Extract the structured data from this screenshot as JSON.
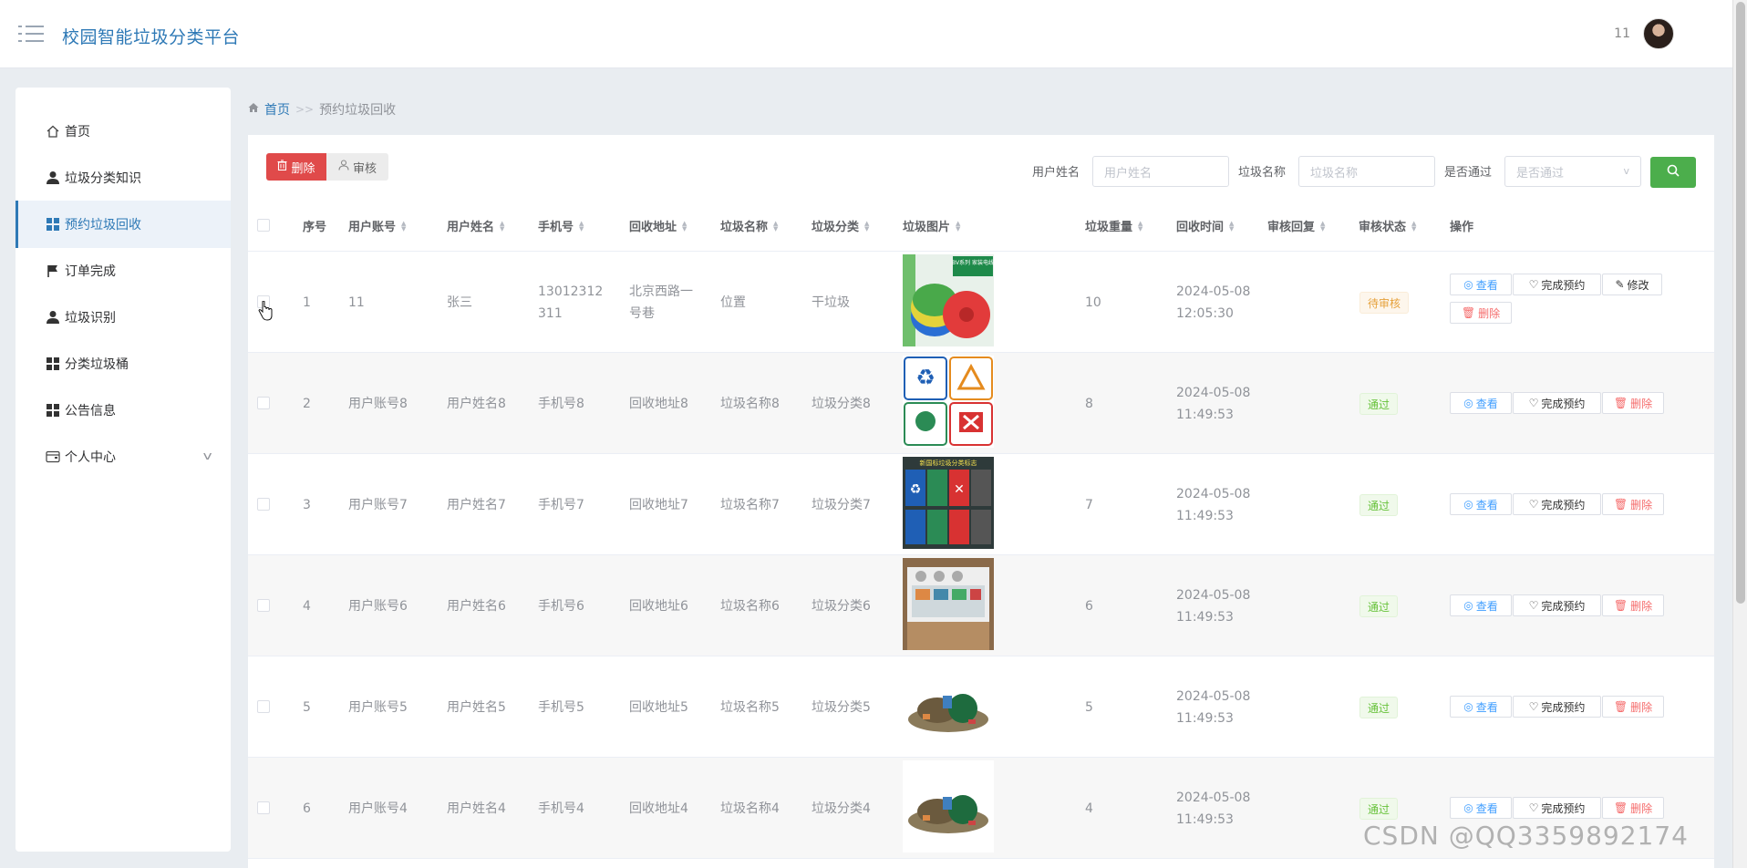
{
  "header": {
    "app_title": "校园智能垃圾分类平台",
    "user_name": "11"
  },
  "sidebar": {
    "items": [
      {
        "label": "首页",
        "icon": "home-icon"
      },
      {
        "label": "垃圾分类知识",
        "icon": "user-icon"
      },
      {
        "label": "预约垃圾回收",
        "icon": "grid-icon",
        "active": true
      },
      {
        "label": "订单完成",
        "icon": "flag-icon"
      },
      {
        "label": "垃圾识别",
        "icon": "user-icon"
      },
      {
        "label": "分类垃圾桶",
        "icon": "grid-icon"
      },
      {
        "label": "公告信息",
        "icon": "grid-icon"
      },
      {
        "label": "个人中心",
        "icon": "wallet-icon",
        "expandable": true
      }
    ]
  },
  "breadcrumb": {
    "home": "首页",
    "separator": ">>",
    "current": "预约垃圾回收"
  },
  "toolbar": {
    "delete_label": "删除",
    "audit_label": "审核"
  },
  "filters": {
    "user_name_label": "用户姓名",
    "user_name_placeholder": "用户姓名",
    "trash_name_label": "垃圾名称",
    "trash_name_placeholder": "垃圾名称",
    "approved_label": "是否通过",
    "approved_placeholder": "是否通过"
  },
  "table": {
    "columns": [
      "序号",
      "用户账号",
      "用户姓名",
      "手机号",
      "回收地址",
      "垃圾名称",
      "垃圾分类",
      "垃圾图片",
      "垃圾重量",
      "回收时间",
      "审核回复",
      "审核状态",
      "操作"
    ],
    "actions": {
      "view": "查看",
      "complete": "完成预约",
      "edit": "修改",
      "delete": "删除"
    },
    "rows": [
      {
        "no": "1",
        "account": "11",
        "name": "张三",
        "phone": "13012312311",
        "address": "北京西路一号巷",
        "trash_name": "位置",
        "category": "干垃圾",
        "image": "cables-photo",
        "weight": "10",
        "date": "2024-05-08",
        "time": "12:05:30",
        "reply": "",
        "status": "待审核",
        "status_type": "pending"
      },
      {
        "no": "2",
        "account": "用户账号8",
        "name": "用户姓名8",
        "phone": "手机号8",
        "address": "回收地址8",
        "trash_name": "垃圾名称8",
        "category": "垃圾分类8",
        "image": "recycle-signs-image",
        "weight": "8",
        "date": "2024-05-08",
        "time": "11:49:53",
        "reply": "",
        "status": "通过",
        "status_type": "pass"
      },
      {
        "no": "3",
        "account": "用户账号7",
        "name": "用户姓名7",
        "phone": "手机号7",
        "address": "回收地址7",
        "trash_name": "垃圾名称7",
        "category": "垃圾分类7",
        "image": "sorting-poster-image",
        "weight": "7",
        "date": "2024-05-08",
        "time": "11:49:53",
        "reply": "",
        "status": "通过",
        "status_type": "pass"
      },
      {
        "no": "4",
        "account": "用户账号6",
        "name": "用户姓名6",
        "phone": "手机号6",
        "address": "回收地址6",
        "trash_name": "垃圾名称6",
        "category": "垃圾分类6",
        "image": "bins-photo",
        "weight": "6",
        "date": "2024-05-08",
        "time": "11:49:53",
        "reply": "",
        "status": "通过",
        "status_type": "pass"
      },
      {
        "no": "5",
        "account": "用户账号5",
        "name": "用户姓名5",
        "phone": "手机号5",
        "address": "回收地址5",
        "trash_name": "垃圾名称5",
        "category": "垃圾分类5",
        "image": "trash-pile-photo",
        "weight": "5",
        "date": "2024-05-08",
        "time": "11:49:53",
        "reply": "",
        "status": "通过",
        "status_type": "pass"
      },
      {
        "no": "6",
        "account": "用户账号4",
        "name": "用户姓名4",
        "phone": "手机号4",
        "address": "回收地址4",
        "trash_name": "垃圾名称4",
        "category": "垃圾分类4",
        "image": "trash-pile-photo",
        "weight": "4",
        "date": "2024-05-08",
        "time": "11:49:53",
        "reply": "",
        "status": "通过",
        "status_type": "pass"
      }
    ]
  },
  "image_text": {
    "cables_brand": "BV系列 家装电线",
    "poster_title": "新国标垃圾分类标志"
  },
  "watermark": "CSDN @QQ3359892174",
  "colors": {
    "brand": "#2e79b6",
    "danger": "#e04a4a",
    "success": "#4cae4c",
    "pass": "#67c23a",
    "pending": "#e6a23c"
  }
}
